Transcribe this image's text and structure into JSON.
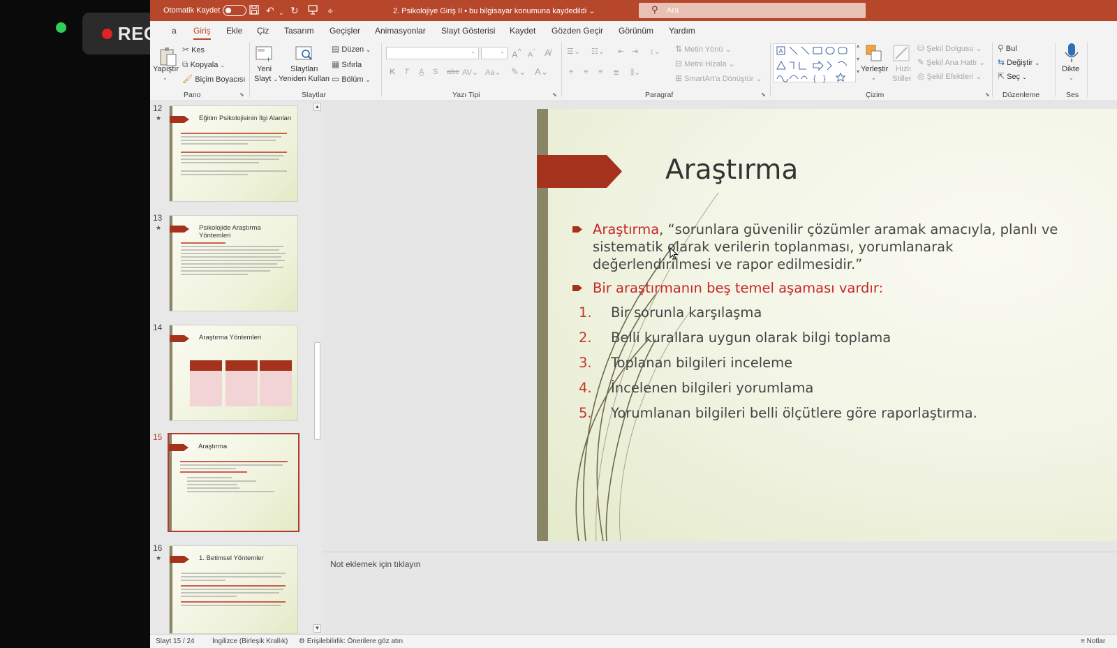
{
  "overlay": {
    "rec_label": "REC"
  },
  "titlebar": {
    "autosave_label": "Otomatik Kaydet",
    "document_title": "2. Psikolojiye Giriş II  •  bu bilgisayar konumuna kaydedildi  ⌄",
    "search_placeholder": "Ara"
  },
  "tabs": [
    "a",
    "Giriş",
    "Ekle",
    "Çiz",
    "Tasarım",
    "Geçişler",
    "Animasyonlar",
    "Slayt Gösterisi",
    "Kaydet",
    "Gözden Geçir",
    "Görünüm",
    "Yardım"
  ],
  "ribbon": {
    "pano": {
      "paste": "Yapıştır",
      "cut": "Kes",
      "copy": "Kopyala",
      "format_painter": "Biçim Boyacısı",
      "label": "Pano"
    },
    "slaytlar": {
      "new_slide_1": "Yeni",
      "new_slide_2": "Slayt",
      "reuse_1": "Slaytları",
      "reuse_2": "Yeniden Kullan",
      "layout": "Düzen",
      "reset": "Sıfırla",
      "section": "Bölüm",
      "label": "Slaytlar"
    },
    "yazi_tipi": {
      "label": "Yazı Tipi"
    },
    "paragraf": {
      "text_direction": "Metin Yönü",
      "align_text": "Metni Hizala",
      "smartart": "SmartArt'a Dönüştür",
      "label": "Paragraf"
    },
    "cizim": {
      "arrange": "Yerleştir",
      "quick_styles_1": "Hızlı",
      "quick_styles_2": "Stiller",
      "shape_fill": "Şekil Dolgusu",
      "shape_outline": "Şekil Ana Hattı",
      "shape_effects": "Şekil Efektleri",
      "label": "Çizim"
    },
    "duzenleme": {
      "find": "Bul",
      "replace": "Değiştir",
      "select": "Seç",
      "label": "Düzenleme"
    },
    "ses": {
      "dictate": "Dikte",
      "label": "Ses"
    }
  },
  "thumbnails": [
    {
      "number": "12",
      "title": "Eğitim Psikolojisinin İlgi Alanları"
    },
    {
      "number": "13",
      "title": "Psikolojide Araştırma Yöntemleri"
    },
    {
      "number": "14",
      "title": "Araştırma Yöntemleri"
    },
    {
      "number": "15",
      "title": "Araştırma"
    },
    {
      "number": "16",
      "title": "1. Betimsel Yöntemler"
    }
  ],
  "slide": {
    "title": "Araştırma",
    "bullet1_term": "Araştırma",
    "bullet1_rest": ", “sorunlara güvenilir çözümler aramak amacıyla, planlı ve sistematik olarak verilerin toplanması, yorumlanarak değerlendirilmesi ve rapor edilmesidir.”",
    "bullet2": "Bir araştırmanın beş temel aşaması vardır:",
    "steps": [
      {
        "n": "1.",
        "text": "Bir sorunla karşılaşma"
      },
      {
        "n": "2.",
        "text": "Belli kurallara uygun olarak bilgi toplama"
      },
      {
        "n": "3.",
        "text": "Toplanan bilgileri inceleme"
      },
      {
        "n": "4.",
        "text": "İncelenen bilgileri yorumlama"
      },
      {
        "n": "5.",
        "text": "Yorumlanan bilgileri belli ölçütlere göre raporlaştırma."
      }
    ]
  },
  "notes": {
    "placeholder": "Not eklemek için tıklayın"
  },
  "status": {
    "slide_counter": "Slayt 15 / 24",
    "language": "İngilizce (Birleşik Krallık)",
    "accessibility": "Erişilebilirlik: Önerilere göz atın",
    "notes_button": "Notlar"
  },
  "colors": {
    "accent": "#b7472a",
    "slide_red": "#a4321c",
    "text_red": "#c62828"
  }
}
